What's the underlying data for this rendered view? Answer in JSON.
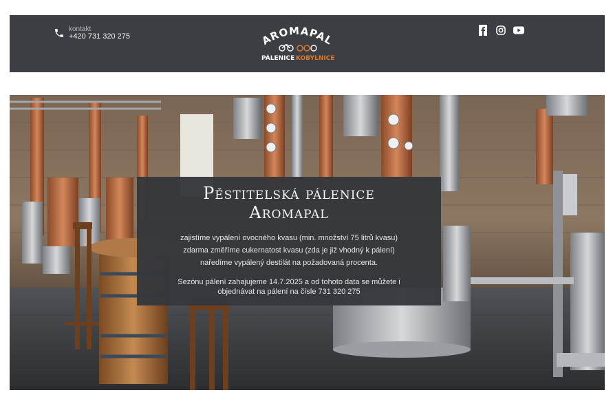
{
  "header": {
    "contact_label": "kontakt",
    "contact_phone": "+420 731 320 275",
    "logo_top": "AROMAPAL",
    "logo_bottom_left": "PÁLENICE",
    "logo_bottom_right": "KOBYLNICE",
    "socials": [
      "facebook-icon",
      "instagram-icon",
      "youtube-icon"
    ]
  },
  "hero": {
    "title_line1": "Pěstitelská pálenice",
    "title_line2": "Aromapal",
    "lines": [
      "zajistíme vypálení ovocného kvasu (min. množství 75 litrů kvasu)",
      "zdarma změříme cukernatost kvasu (zda je již vhodný k pálení)",
      "naředíme vypálený destilát na požadovaná procenta."
    ],
    "season_line1": "Sezónu pálení zahajujeme 14.7.2025 a od tohoto data se můžete i",
    "season_line2": "objednávat na pálení na čísle 731 320 275"
  },
  "colors": {
    "header_bg": "#3b3e42",
    "logo_orange": "#e07a2a",
    "box_bg": "#34373b"
  }
}
